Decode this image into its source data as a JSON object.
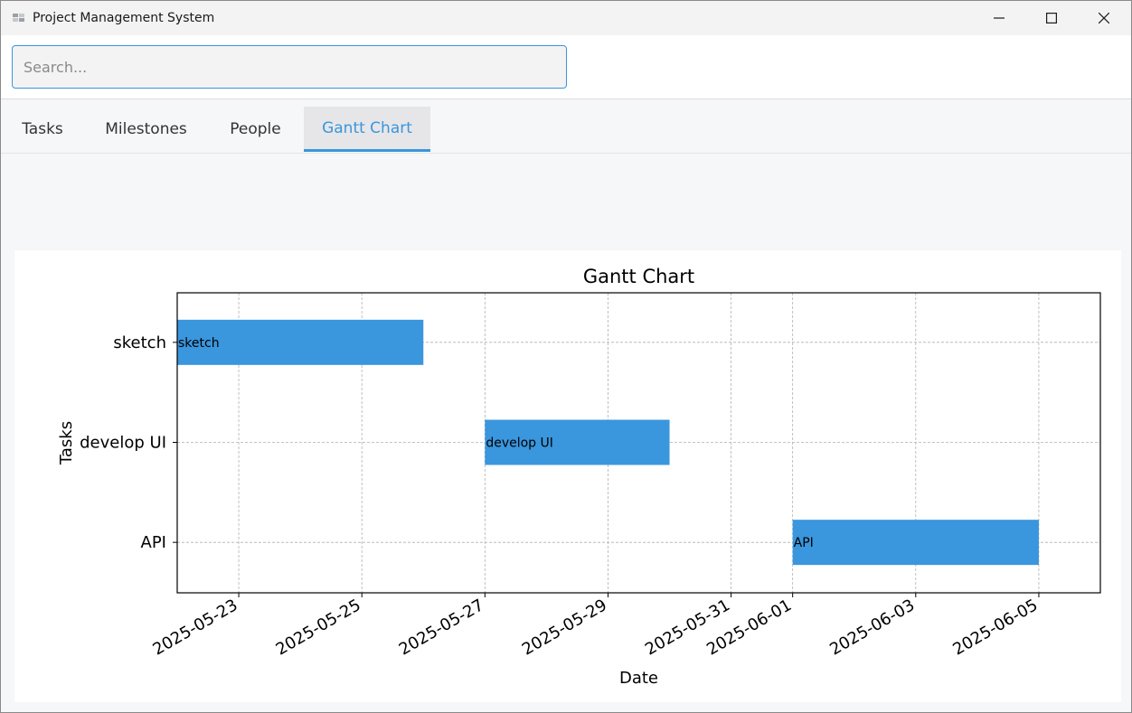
{
  "window": {
    "title": "Project Management System",
    "icon": "app-icon"
  },
  "search": {
    "placeholder": "Search...",
    "value": ""
  },
  "tabs": [
    {
      "label": "Tasks",
      "active": false
    },
    {
      "label": "Milestones",
      "active": false
    },
    {
      "label": "People",
      "active": false
    },
    {
      "label": "Gantt Chart",
      "active": true
    }
  ],
  "colors": {
    "accent": "#3a96dd",
    "bar": "#3a96dd"
  },
  "chart_data": {
    "type": "gantt",
    "title": "Gantt Chart",
    "xlabel": "Date",
    "ylabel": "Tasks",
    "xlim": [
      "2025-05-22",
      "2025-06-06"
    ],
    "grid": true,
    "x_ticks": [
      "2025-05-23",
      "2025-05-25",
      "2025-05-27",
      "2025-05-29",
      "2025-05-31",
      "2025-06-01",
      "2025-06-03",
      "2025-06-05"
    ],
    "tasks": [
      {
        "name": "sketch",
        "start": "2025-05-22",
        "end": "2025-05-26",
        "label": "sketch"
      },
      {
        "name": "develop UI",
        "start": "2025-05-27",
        "end": "2025-05-30",
        "label": "develop UI"
      },
      {
        "name": "API",
        "start": "2025-06-01",
        "end": "2025-06-05",
        "label": "API"
      }
    ]
  }
}
